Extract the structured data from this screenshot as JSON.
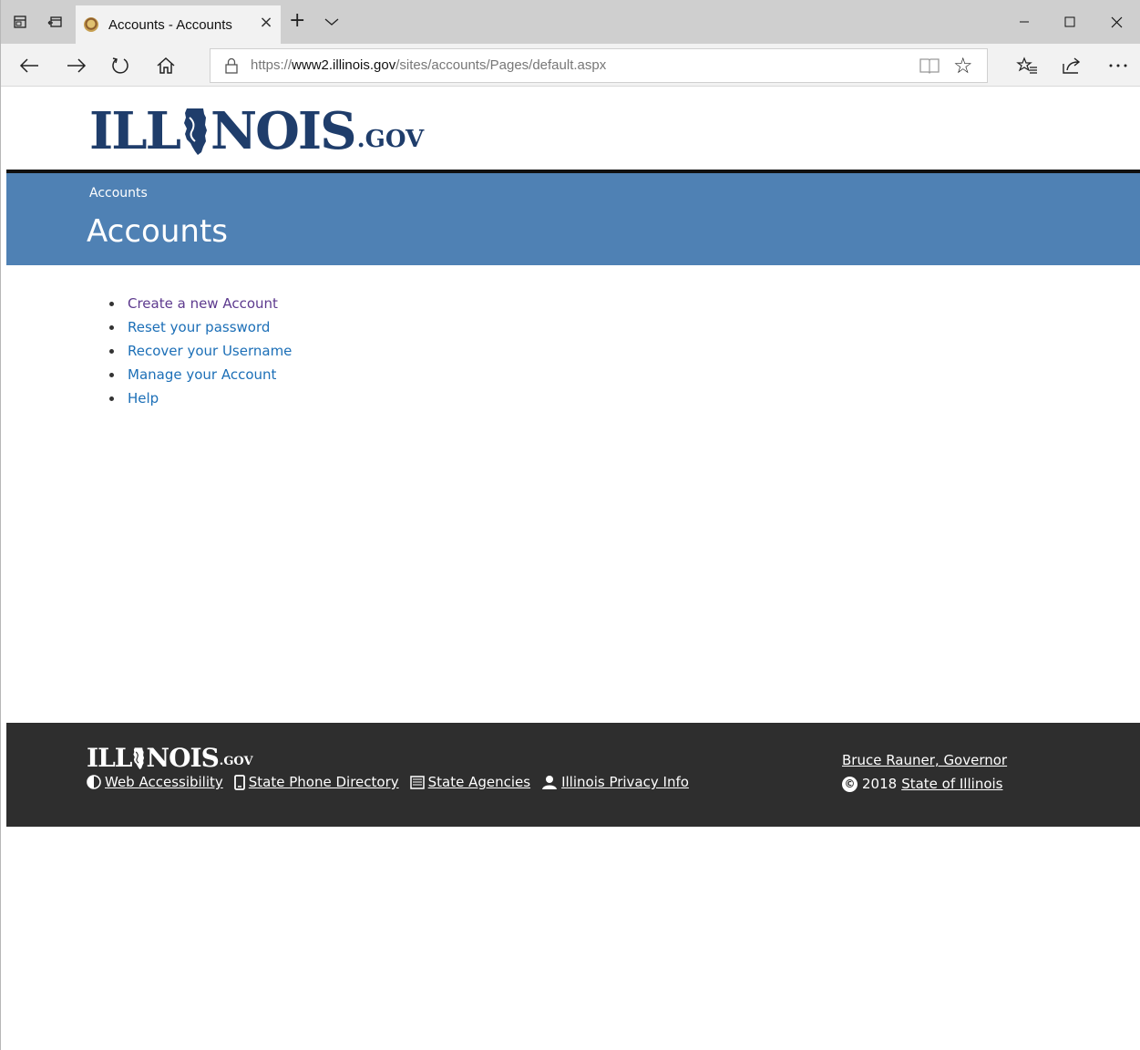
{
  "browser": {
    "tab_title": "Accounts - Accounts",
    "new_tab_symbol": "+",
    "close_tab_symbol": "×",
    "url": {
      "scheme": "https://",
      "host": "www2.illinois.gov",
      "path": "/sites/accounts/Pages/default.aspx"
    },
    "icons": [
      "tab-preview-icon",
      "set-aside-tabs-icon",
      "tab-list-chevron-icon",
      "minimize-icon",
      "maximize-icon",
      "close-window-icon",
      "back-icon",
      "forward-icon",
      "refresh-icon",
      "home-icon",
      "lock-icon",
      "reading-view-icon",
      "favorite-star-icon",
      "favorites-hub-icon",
      "share-icon",
      "more-icon"
    ]
  },
  "header": {
    "logo_left": "ILL",
    "logo_right": "NOIS",
    "logo_suffix": ".GOV",
    "breadcrumb": "Accounts",
    "title": "Accounts",
    "banner_color": "#4f81b4"
  },
  "links": [
    {
      "label": "Create a new Account",
      "visited": true
    },
    {
      "label": "Reset your password",
      "visited": false
    },
    {
      "label": "Recover your Username",
      "visited": false
    },
    {
      "label": "Manage your Account",
      "visited": false
    },
    {
      "label": "Help",
      "visited": false
    }
  ],
  "footer": {
    "logo_left": "ILL",
    "logo_right": "NOIS",
    "logo_suffix": ".GOV",
    "links": [
      {
        "label": "Web Accessibility",
        "icon": "accessibility-contrast-icon"
      },
      {
        "label": "State Phone Directory",
        "icon": "phone-icon"
      },
      {
        "label": "State Agencies",
        "icon": "list-icon"
      },
      {
        "label": "Illinois Privacy Info",
        "icon": "person-icon"
      }
    ],
    "governor": "Bruce Rauner, Governor",
    "copyright_symbol": "©",
    "copyright_year": "2018",
    "copyright_link": "State of Illinois",
    "background": "#2e2e2e"
  }
}
